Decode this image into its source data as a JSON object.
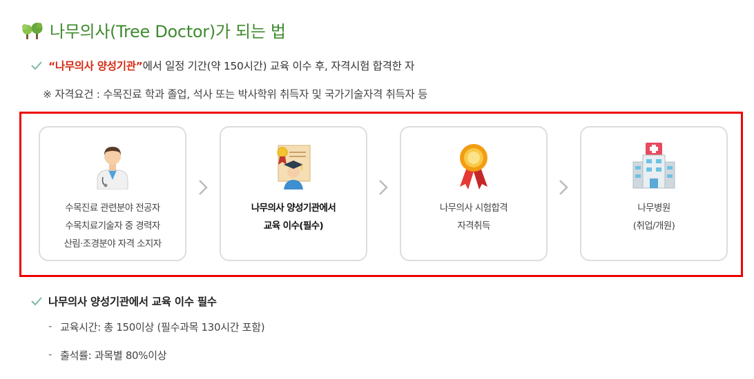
{
  "title": "나무의사(Tree Doctor)가 되는 법",
  "requirement": {
    "highlight": "“나무의사 양성기관”",
    "text": "에서 일정 기간(약 150시간) 교육 이수 후, 자격시험 합격한 자"
  },
  "note": "※ 자격요건 : 수목진료 학과 졸업, 석사 또는 박사학위 취득자 및 국가기술자격 취득자 등",
  "steps": [
    {
      "icon": "doctor-icon",
      "lines": [
        "수목진료 관련분야 전공자",
        "수목치료기술자 중 경력자",
        "산림·조경분야 자격 소지자"
      ]
    },
    {
      "icon": "graduate-certificate-icon",
      "lines": [
        "나무의사 양성기관에서",
        "교육 이수(필수)"
      ]
    },
    {
      "icon": "award-medal-icon",
      "lines": [
        "나무의사 시험합격",
        "자격취득"
      ]
    },
    {
      "icon": "hospital-icon",
      "lines": [
        "나무병원",
        "(취업/개원)"
      ]
    }
  ],
  "education": {
    "heading": "나무의사 양성기관에서 교육 이수 필수",
    "items": [
      {
        "dash": "-",
        "text": "교육시간: 총 150이상 (필수과목 130시간 포함)"
      },
      {
        "dash": "-",
        "text": "출석률: 과목별 80%이상"
      }
    ]
  },
  "colors": {
    "title": "#3f8a2f",
    "highlight": "#d52a14",
    "frame": "#ee0000",
    "check": "#7fb8a0"
  }
}
